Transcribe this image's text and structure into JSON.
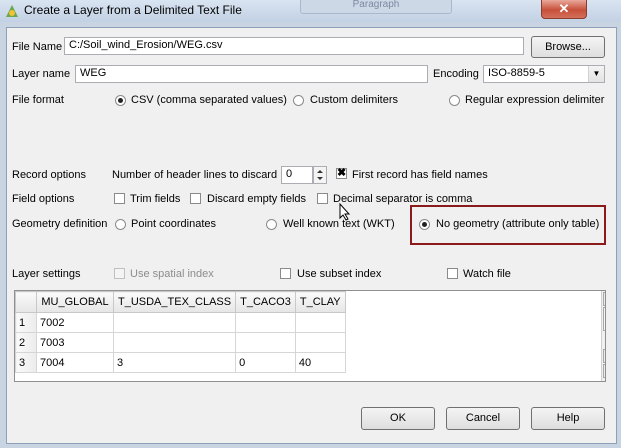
{
  "window": {
    "title": "Create a Layer from a Delimited Text File",
    "background_tab": "Paragraph",
    "close_glyph": "✕"
  },
  "file": {
    "label": "File Name",
    "value": "C:/Soil_wind_Erosion/WEG.csv",
    "browse": "Browse..."
  },
  "layer": {
    "label": "Layer name",
    "value": "WEG",
    "encoding_label": "Encoding",
    "encoding_value": "ISO-8859-5"
  },
  "format": {
    "label": "File format",
    "options": [
      "CSV (comma separated values)",
      "Custom delimiters",
      "Regular expression delimiter"
    ],
    "selected": 0
  },
  "record": {
    "label": "Record options",
    "header_lines_label": "Number of header lines to discard",
    "header_lines_value": "0",
    "first_record_label": "First record has field names",
    "first_record_checked": true
  },
  "fields": {
    "label": "Field options",
    "trim": "Trim fields",
    "discard": "Discard empty fields",
    "decimal": "Decimal separator is comma"
  },
  "geometry": {
    "label": "Geometry definition",
    "options": [
      "Point coordinates",
      "Well known text (WKT)",
      "No geometry (attribute only table)"
    ],
    "selected": 2
  },
  "settings": {
    "label": "Layer settings",
    "spatial_index": "Use spatial index",
    "subset_index": "Use subset index",
    "watch_file": "Watch file"
  },
  "table": {
    "columns": [
      "MU_GLOBAL",
      "T_USDA_TEX_CLASS",
      "T_CACO3",
      "T_CLAY"
    ],
    "rows": [
      {
        "num": "1",
        "cells": [
          "7002",
          "",
          "",
          ""
        ]
      },
      {
        "num": "2",
        "cells": [
          "7003",
          "",
          "",
          ""
        ]
      },
      {
        "num": "3",
        "cells": [
          "7004",
          "3",
          "0",
          "40"
        ]
      }
    ]
  },
  "buttons": {
    "ok": "OK",
    "cancel": "Cancel",
    "help": "Help"
  },
  "colors": {
    "highlight_border": "#8b1a1a"
  }
}
